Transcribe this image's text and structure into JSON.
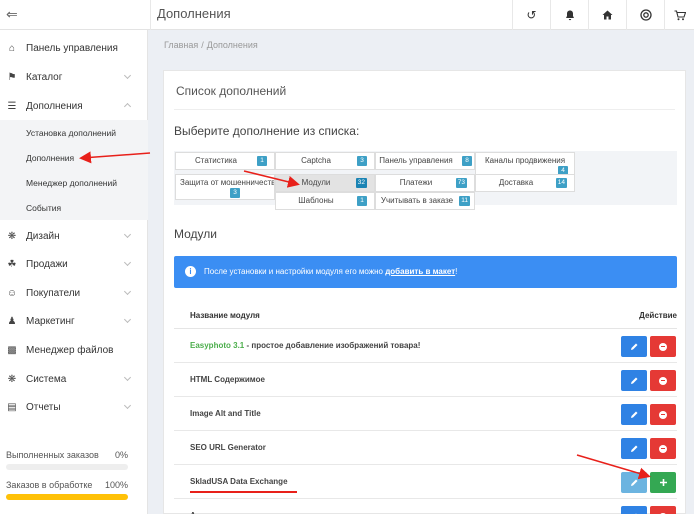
{
  "header": {
    "back_icon": "collapse-icon",
    "title": "Дополнения",
    "icons": [
      "history-icon",
      "bell-icon",
      "home-icon",
      "support-icon",
      "cart-icon"
    ]
  },
  "sidebar": {
    "items": [
      {
        "label": "Панель управления",
        "icon": "home-icon"
      },
      {
        "label": "Каталог",
        "icon": "tag-icon"
      },
      {
        "label": "Дополнения",
        "icon": "database-icon"
      },
      {
        "label": "Дизайн",
        "icon": "gear-icon"
      },
      {
        "label": "Продажи",
        "icon": "cart-icon"
      },
      {
        "label": "Покупатели",
        "icon": "user-icon"
      },
      {
        "label": "Маркетинг",
        "icon": "person-icon"
      },
      {
        "label": "Менеджер файлов",
        "icon": "file-icon"
      },
      {
        "label": "Система",
        "icon": "gear-icon"
      },
      {
        "label": "Отчеты",
        "icon": "chart-icon"
      }
    ],
    "sub_items": [
      {
        "label": "Установка дополнений"
      },
      {
        "label": "Дополнения"
      },
      {
        "label": "Менеджер дополнений"
      },
      {
        "label": "События"
      }
    ],
    "stats": [
      {
        "label": "Выполненных заказов",
        "value": "0%",
        "fraction": 0
      },
      {
        "label": "Заказов в обработке",
        "value": "100%",
        "fraction": 1
      }
    ]
  },
  "breadcrumb": {
    "home": "Главная",
    "sep": "/",
    "current": "Дополнения"
  },
  "panel": {
    "title": "Список дополнений",
    "choose": "Выберите дополнение из списка:",
    "categories": [
      {
        "label": "Статистика",
        "count": "1"
      },
      {
        "label": "Captcha",
        "count": "3"
      },
      {
        "label": "Панель управления",
        "count": "8"
      },
      {
        "label": "Каналы продвижения",
        "count": "4"
      },
      {
        "label": "Защита от мошенничества",
        "count": "3"
      },
      {
        "label": "Модули",
        "count": "32"
      },
      {
        "label": "Платежи",
        "count": "73"
      },
      {
        "label": "Доставка",
        "count": "14"
      },
      {
        "label": "Шаблоны",
        "count": "1"
      },
      {
        "label": "Учитывать в заказе",
        "count": "11"
      }
    ],
    "section_title": "Модули",
    "alert": {
      "text": "После установки и настройки модуля его можно ",
      "link": "добавить в макет",
      "end": "!"
    },
    "table": {
      "col_name": "Название модуля",
      "col_action": "Действие",
      "rows": [
        {
          "name_green": "Easyphoto 3.1",
          "name": " - простое добавление изображений товара!",
          "installed": true
        },
        {
          "name_green": "",
          "name": "HTML Содержимое",
          "installed": true
        },
        {
          "name_green": "",
          "name": "Image Alt and Title",
          "installed": true
        },
        {
          "name_green": "",
          "name": "SEO URL Generator",
          "installed": true
        },
        {
          "name_green": "",
          "name": "SkladUSA Data Exchange",
          "installed": false
        },
        {
          "name_green": "",
          "name": "А",
          "installed": true
        }
      ]
    }
  },
  "colors": {
    "primary": "#2f82e4",
    "danger": "#e53935",
    "success": "#34a853",
    "info": "#3b8ef3",
    "warning": "#ffc107",
    "annotation": "#e8201a"
  }
}
